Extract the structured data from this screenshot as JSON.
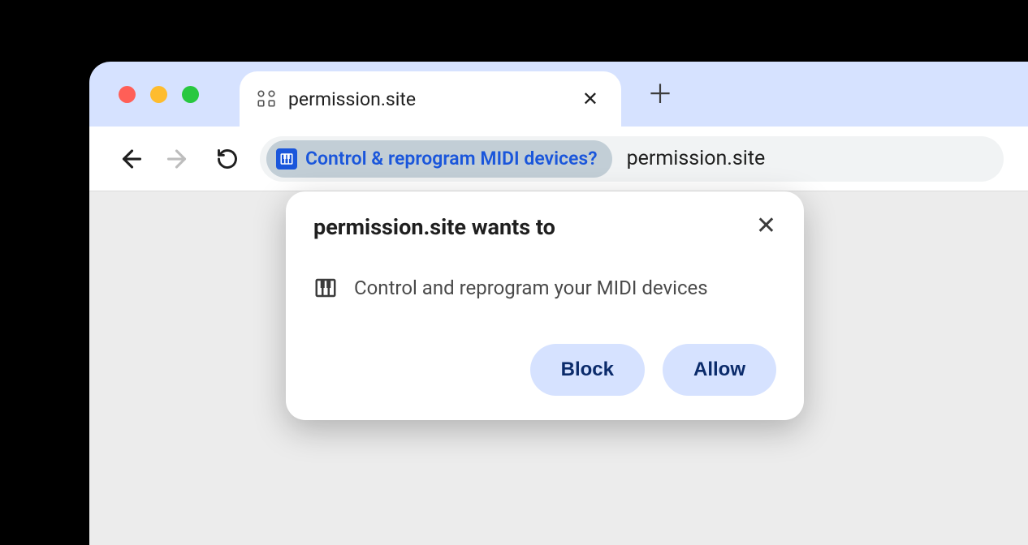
{
  "tab": {
    "title": "permission.site"
  },
  "omnibox": {
    "chip_label": "Control & reprogram MIDI devices?",
    "url": "permission.site"
  },
  "dialog": {
    "title": "permission.site wants to",
    "description": "Control and reprogram your MIDI devices",
    "block_label": "Block",
    "allow_label": "Allow"
  }
}
